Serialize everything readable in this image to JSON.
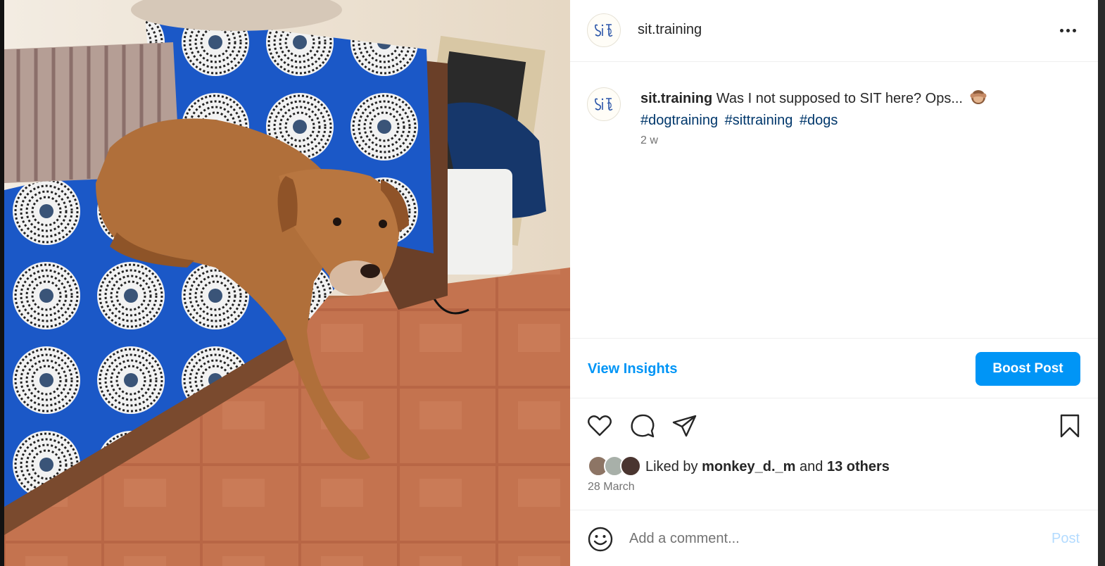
{
  "post": {
    "username": "sit.training",
    "caption_text": "Was I not supposed to SIT here? Ops...",
    "caption_emoji": "see-no-evil-monkey-icon",
    "hashtags": [
      "#dogtraining",
      "#sittraining",
      "#dogs"
    ],
    "time_ago": "2 w",
    "date": "28 March",
    "photo_description": "dog-on-blue-patterned-sofa"
  },
  "insights": {
    "view_label": "View Insights",
    "boost_label": "Boost Post"
  },
  "likes": {
    "prefix": "Liked by",
    "top_user": "monkey_d._m",
    "joiner": "and",
    "others": "13 others"
  },
  "comment": {
    "placeholder": "Add a comment...",
    "post_label": "Post"
  },
  "icons": {
    "more": "more-options-icon",
    "like": "heart-icon",
    "comment": "comment-bubble-icon",
    "share": "paper-plane-icon",
    "save": "bookmark-icon",
    "emoji": "smiley-icon"
  },
  "colors": {
    "accent": "#0095f6",
    "hashtag": "#00376b",
    "muted": "#737373",
    "post_disabled": "#b3dbff"
  }
}
